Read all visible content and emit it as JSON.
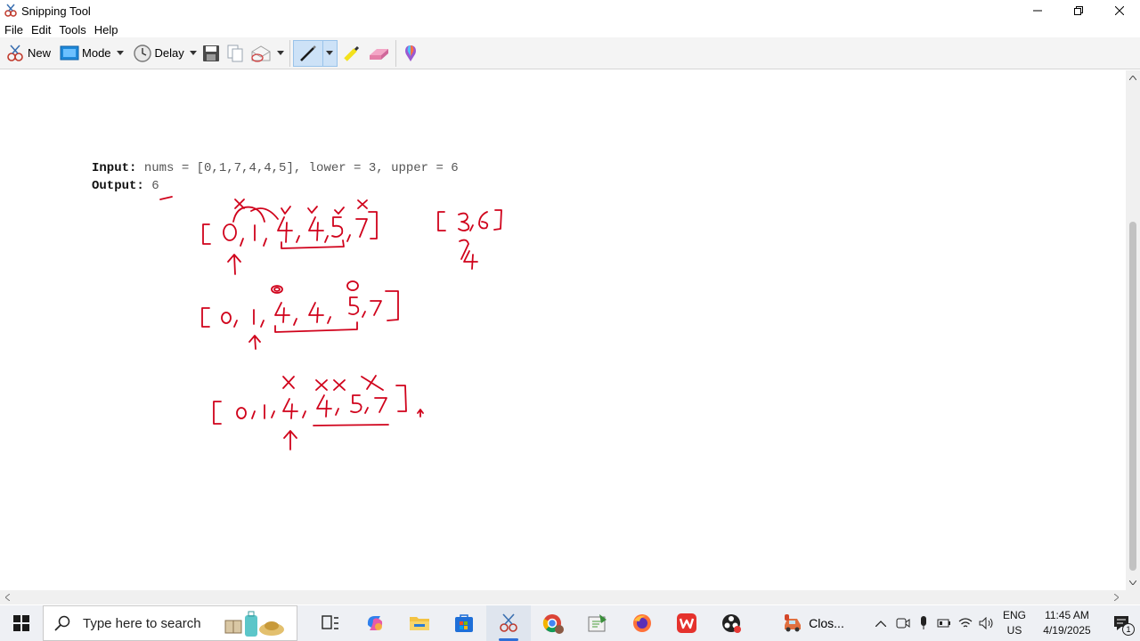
{
  "window": {
    "title": "Snipping Tool"
  },
  "menu": [
    "File",
    "Edit",
    "Tools",
    "Help"
  ],
  "toolbar": {
    "new_label": "New",
    "mode_label": "Mode",
    "delay_label": "Delay"
  },
  "canvas": {
    "input_label": "Input:",
    "input_value": " nums = [0,1,7,4,4,5], lower = 3, upper = 6",
    "output_label": "Output:",
    "output_value": " 6",
    "annotation_color": "#d0021b"
  },
  "taskbar": {
    "search_placeholder": "Type here to search",
    "open_app_label": "Clos...",
    "language_top": "ENG",
    "language_bottom": "US",
    "time": "11:45 AM",
    "date": "4/19/2025",
    "notification_count": "1"
  }
}
